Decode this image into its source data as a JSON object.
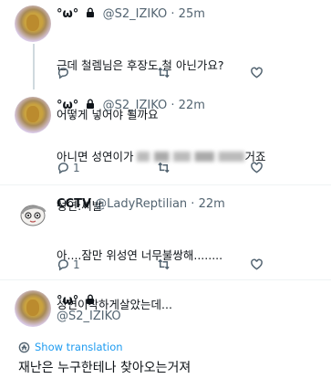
{
  "tweets": [
    {
      "name": "°ω°",
      "handle": "@S2_IZIKO",
      "dot": "·",
      "time": "25m",
      "line1": "근데 철렘님은 후장도 철 아닌가요?",
      "line2": "어떻게 넣어야 될까요",
      "reply_count": "",
      "icons": [
        "reply-icon",
        "retweet-icon",
        "like-icon"
      ]
    },
    {
      "name": "°ω°",
      "handle": "@S2_IZIKO",
      "dot": "·",
      "time": "22m",
      "line1_prefix": "아니면 성연이가 ",
      "line1_blurred": "                   ",
      "line1_suffix": "거죠",
      "line2": "성연:씨발",
      "reply_count": "1"
    },
    {
      "name": "CCTV",
      "handle": "@LadyReptilian",
      "dot": "·",
      "time": "22m",
      "line1": "아....잠만 위성연 너무불쌍해........",
      "line2": "성연이착하게살았는데...",
      "reply_count": "1"
    }
  ],
  "main": {
    "name": "°ω°",
    "handle": "@S2_IZIKO",
    "translate_label": "Show translation",
    "text": "재난은 누구한테나 찾아오는거져"
  }
}
